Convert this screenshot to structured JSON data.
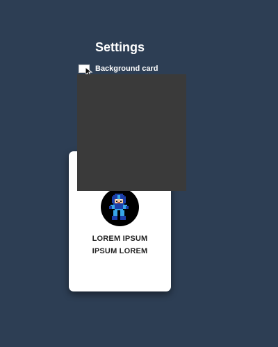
{
  "settings": {
    "title": "Settings",
    "background_card_label": "Background card",
    "background_card_checked": false
  },
  "card": {
    "line1": "LOREM IPSUM",
    "line2": "IPSUM LOREM",
    "avatar_icon": "megaman-sprite-icon"
  },
  "colors": {
    "page_background": "#2d3e54",
    "overlay": "#3a3a3a",
    "card_background": "#ffffff",
    "avatar_background": "#000000"
  }
}
